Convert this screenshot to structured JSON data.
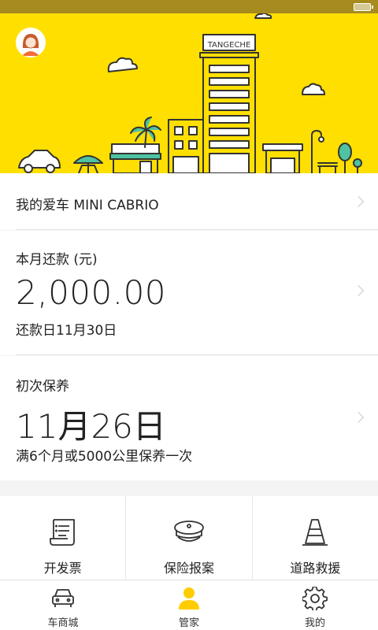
{
  "hero": {
    "building_sign": "TANGECHE",
    "colors": {
      "background": "#ffdf00",
      "outline": "#333333"
    }
  },
  "my_car": {
    "label": "我的爱车 MINI CABRIO"
  },
  "repayment": {
    "title": "本月还款 (元)",
    "amount": "2,000.00",
    "due": "还款日11月30日"
  },
  "maintenance": {
    "title": "初次保养",
    "date": "11月26日",
    "note": "满6个月或5000公里保养一次"
  },
  "services": [
    {
      "label": "开发票",
      "icon": "invoice-icon"
    },
    {
      "label": "保险报案",
      "icon": "insurance-cap-icon"
    },
    {
      "label": "道路救援",
      "icon": "traffic-cone-icon"
    }
  ],
  "tabs": [
    {
      "label": "车商城",
      "icon": "car-icon",
      "active": false
    },
    {
      "label": "管家",
      "icon": "person-icon",
      "active": true
    },
    {
      "label": "我的",
      "icon": "gear-icon",
      "active": false
    }
  ],
  "accent_color": "#ffcc00"
}
